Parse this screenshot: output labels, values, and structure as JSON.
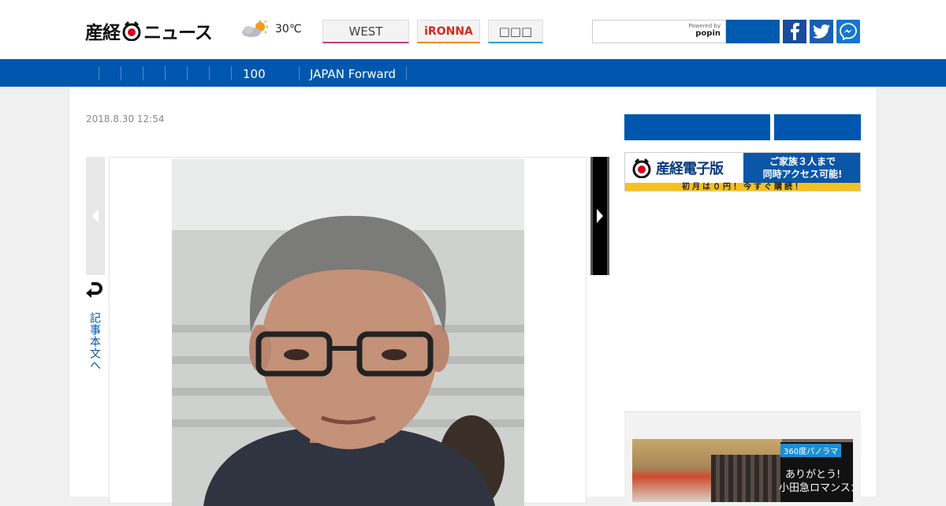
{
  "header": {
    "logo_text": "産経",
    "logo_text2": "ニュース",
    "weather_temp": "30℃",
    "tabs": [
      {
        "label": "WEST"
      },
      {
        "label": "iRONNA"
      },
      {
        "label": "□□□"
      }
    ],
    "search": {
      "placeholder": "",
      "powered_by": "Powered by",
      "powered_brand": "popin"
    },
    "colors": {
      "brand_blue": "#0057ad",
      "west_accent": "#c0407a",
      "ironna_accent": "#e98b1c"
    }
  },
  "nav": {
    "items": [
      {
        "label": "100"
      },
      {
        "label": "JAPAN Forward"
      }
    ]
  },
  "article": {
    "date": "2018.8.30 12:54",
    "back_to_text": "記事本文へ"
  },
  "sidebar": {
    "banner": {
      "brand": "産経電子版",
      "right_line1": "ご家族３人まで",
      "right_line2": "同時アクセス可能!",
      "bottom": "初月は０円！今すぐ購読！"
    },
    "widget": {
      "tag": "360度パノラマ",
      "caption_line1": "ありがとう!",
      "caption_line2": "小田急ロマンスカー"
    }
  }
}
